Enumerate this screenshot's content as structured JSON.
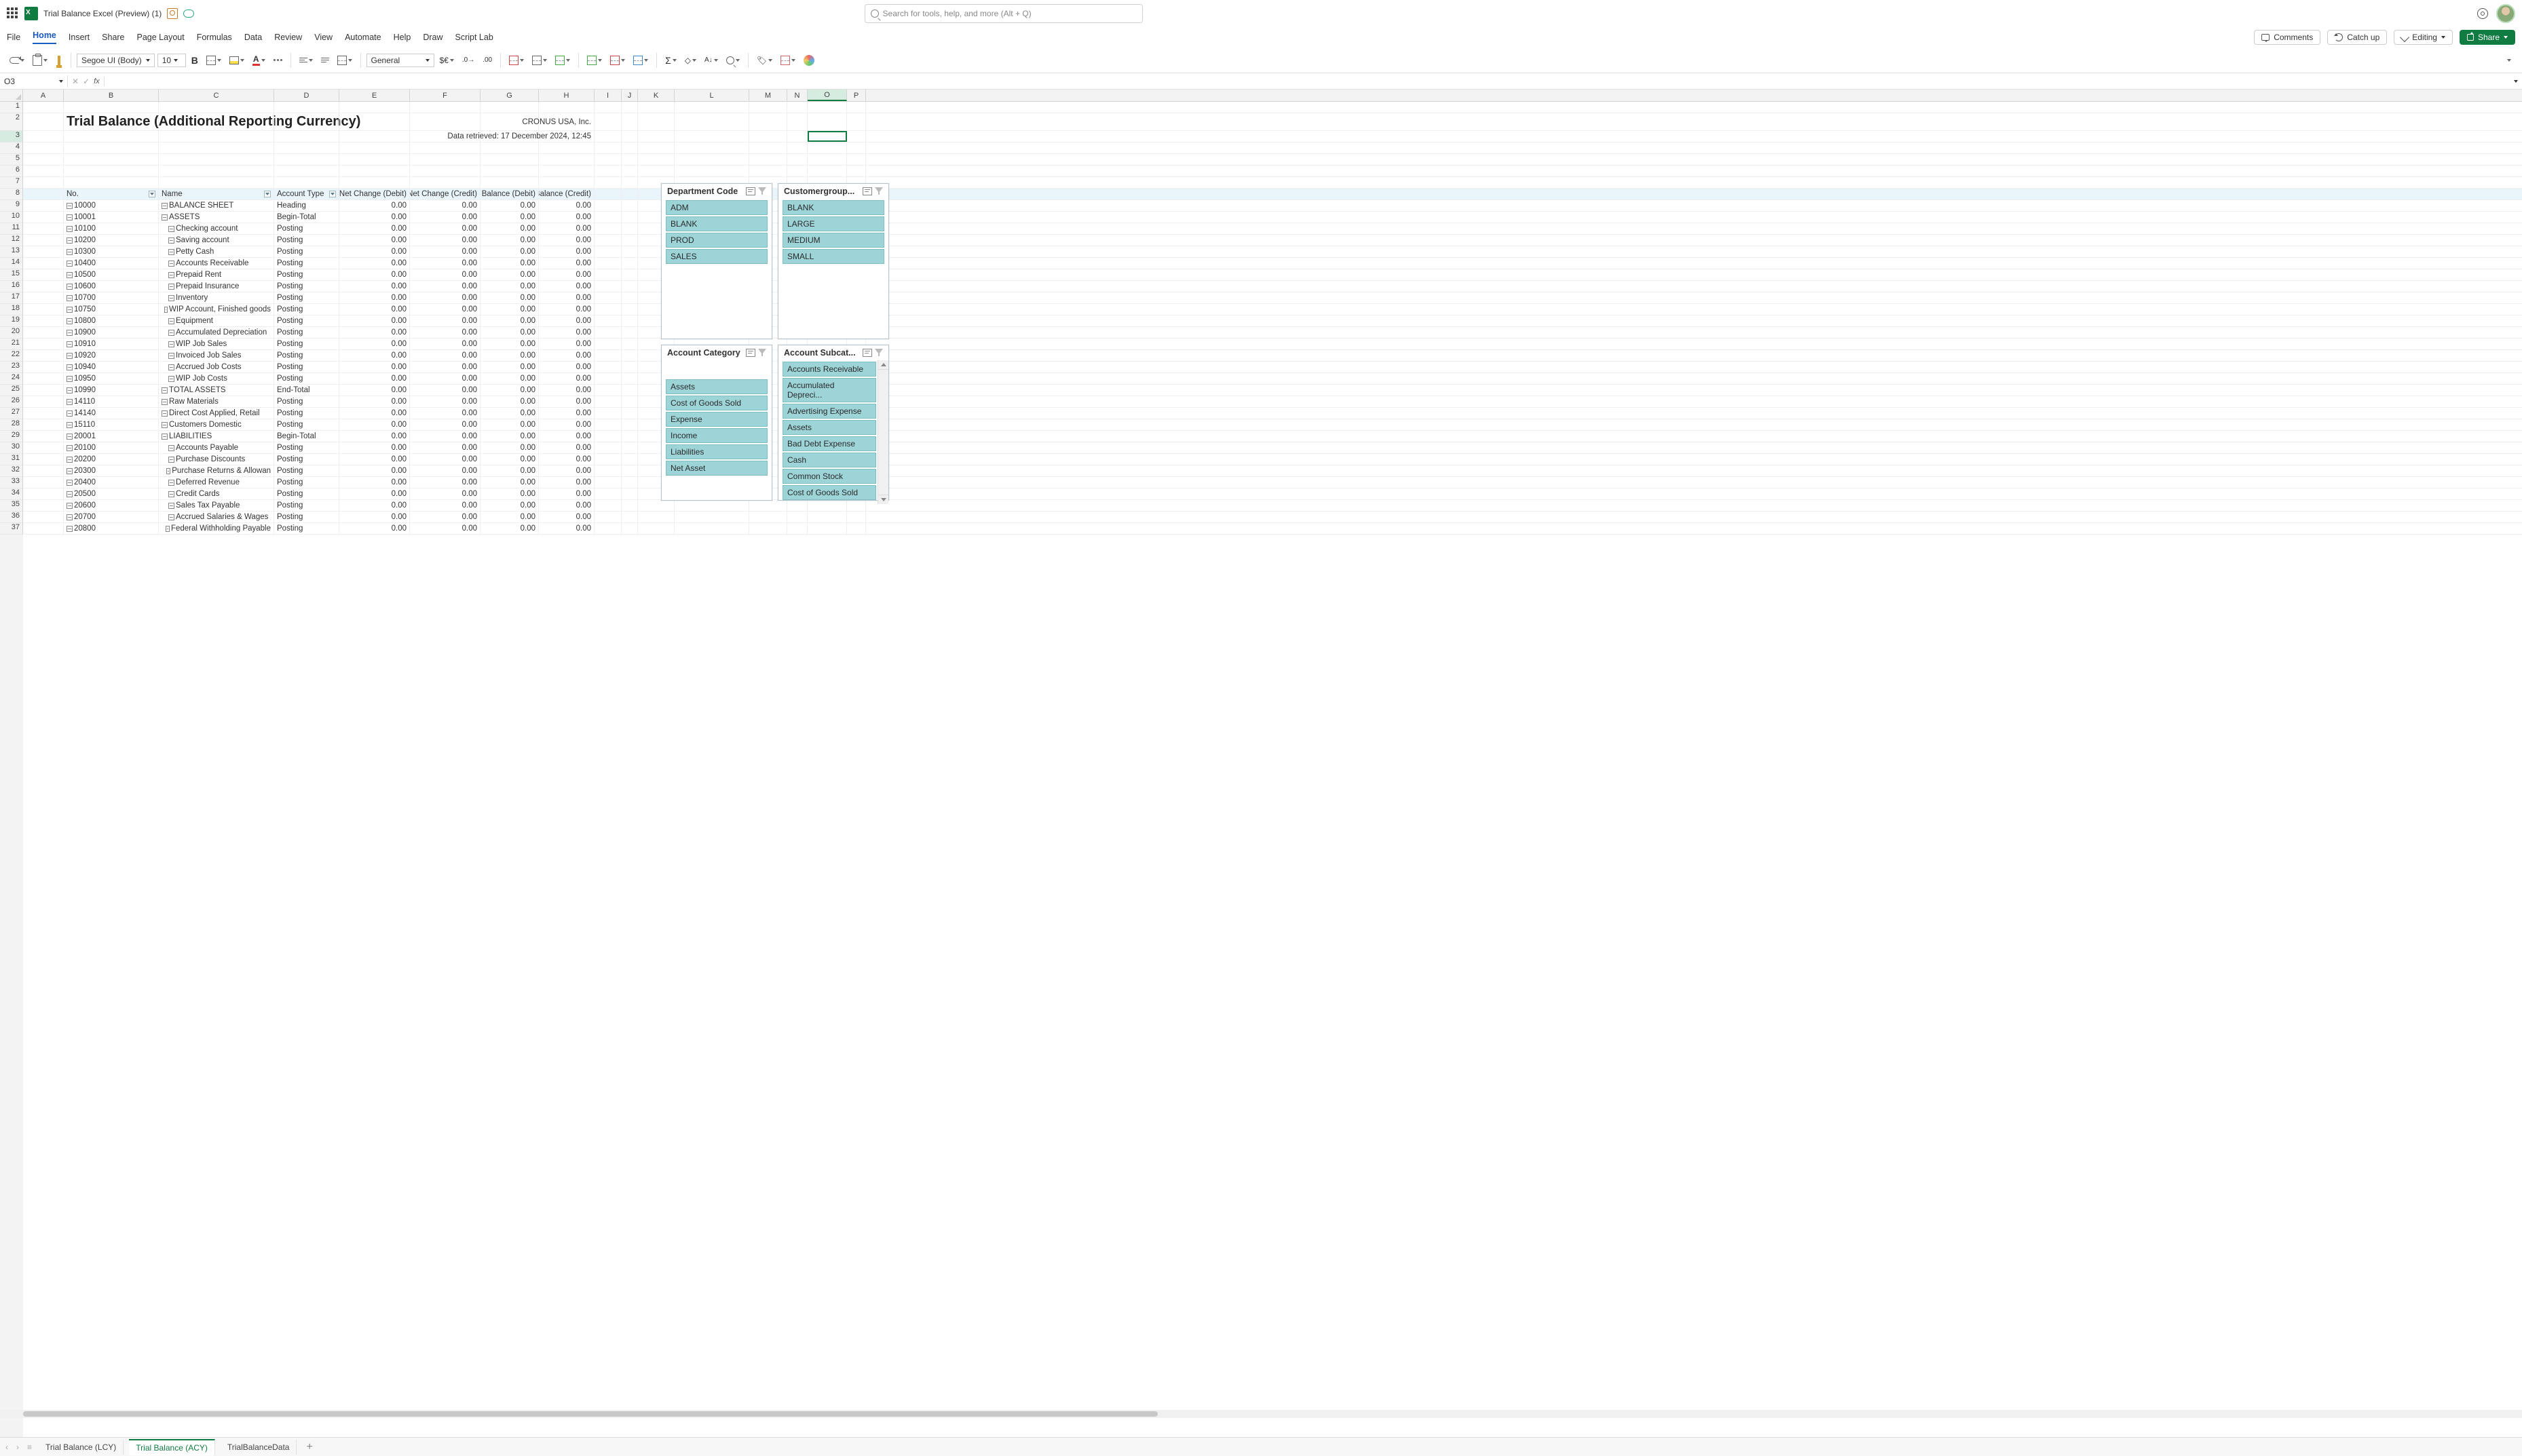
{
  "topbar": {
    "doc_title": "Trial Balance Excel (Preview) (1)",
    "search_placeholder": "Search for tools, help, and more (Alt + Q)"
  },
  "menubar": {
    "items": [
      "File",
      "Home",
      "Insert",
      "Share",
      "Page Layout",
      "Formulas",
      "Data",
      "Review",
      "View",
      "Automate",
      "Help",
      "Draw",
      "Script Lab"
    ],
    "active_index": 1,
    "comments": "Comments",
    "catch_up": "Catch up",
    "editing": "Editing",
    "share": "Share"
  },
  "ribbon": {
    "font_name": "Segoe UI (Body)",
    "font_size": "10",
    "number_format": "General"
  },
  "fxbar": {
    "namebox": "O3",
    "formula": ""
  },
  "columns": [
    "A",
    "B",
    "C",
    "D",
    "E",
    "F",
    "G",
    "H",
    "I",
    "J",
    "K",
    "L",
    "M",
    "N",
    "O",
    "P"
  ],
  "row_count_total": 37,
  "report": {
    "title": "Trial Balance (Additional Reporting Currency)",
    "company": "CRONUS USA, Inc.",
    "retrieved": "Data retrieved: 17 December 2024, 12:45"
  },
  "table": {
    "headers": [
      "No.",
      "Name",
      "Account Type",
      "Net Change (Debit)",
      "Net Change (Credit)",
      "Balance (Debit)",
      "Balance (Credit)"
    ],
    "rows": [
      {
        "no": "10000",
        "name": "BALANCE SHEET",
        "type": "Heading",
        "d": "0.00",
        "e": "0.00",
        "f": "0.00",
        "g": "0.00",
        "oA": true,
        "oB": true
      },
      {
        "no": "10001",
        "name": "ASSETS",
        "type": "Begin-Total",
        "d": "0.00",
        "e": "0.00",
        "f": "0.00",
        "g": "0.00",
        "oA": true,
        "oB": true
      },
      {
        "no": "10100",
        "name": "Checking account",
        "type": "Posting",
        "d": "0.00",
        "e": "0.00",
        "f": "0.00",
        "g": "0.00",
        "oA": true,
        "oB": false,
        "ind": true
      },
      {
        "no": "10200",
        "name": "Saving account",
        "type": "Posting",
        "d": "0.00",
        "e": "0.00",
        "f": "0.00",
        "g": "0.00",
        "oA": true,
        "oB": false,
        "ind": true
      },
      {
        "no": "10300",
        "name": "Petty Cash",
        "type": "Posting",
        "d": "0.00",
        "e": "0.00",
        "f": "0.00",
        "g": "0.00",
        "oA": true,
        "oB": false,
        "ind": true
      },
      {
        "no": "10400",
        "name": "Accounts Receivable",
        "type": "Posting",
        "d": "0.00",
        "e": "0.00",
        "f": "0.00",
        "g": "0.00",
        "oA": true,
        "oB": false,
        "ind": true
      },
      {
        "no": "10500",
        "name": "Prepaid Rent",
        "type": "Posting",
        "d": "0.00",
        "e": "0.00",
        "f": "0.00",
        "g": "0.00",
        "oA": true,
        "oB": false,
        "ind": true
      },
      {
        "no": "10600",
        "name": "Prepaid Insurance",
        "type": "Posting",
        "d": "0.00",
        "e": "0.00",
        "f": "0.00",
        "g": "0.00",
        "oA": true,
        "oB": false,
        "ind": true
      },
      {
        "no": "10700",
        "name": "Inventory",
        "type": "Posting",
        "d": "0.00",
        "e": "0.00",
        "f": "0.00",
        "g": "0.00",
        "oA": true,
        "oB": false,
        "ind": true
      },
      {
        "no": "10750",
        "name": "WIP Account, Finished goods",
        "type": "Posting",
        "d": "0.00",
        "e": "0.00",
        "f": "0.00",
        "g": "0.00",
        "oA": true,
        "oB": false,
        "ind": true
      },
      {
        "no": "10800",
        "name": "Equipment",
        "type": "Posting",
        "d": "0.00",
        "e": "0.00",
        "f": "0.00",
        "g": "0.00",
        "oA": true,
        "oB": false,
        "ind": true
      },
      {
        "no": "10900",
        "name": "Accumulated Depreciation",
        "type": "Posting",
        "d": "0.00",
        "e": "0.00",
        "f": "0.00",
        "g": "0.00",
        "oA": true,
        "oB": false,
        "ind": true
      },
      {
        "no": "10910",
        "name": "WIP Job Sales",
        "type": "Posting",
        "d": "0.00",
        "e": "0.00",
        "f": "0.00",
        "g": "0.00",
        "oA": true,
        "oB": false,
        "ind": true
      },
      {
        "no": "10920",
        "name": "Invoiced Job Sales",
        "type": "Posting",
        "d": "0.00",
        "e": "0.00",
        "f": "0.00",
        "g": "0.00",
        "oA": true,
        "oB": false,
        "ind": true
      },
      {
        "no": "10940",
        "name": "Accrued Job Costs",
        "type": "Posting",
        "d": "0.00",
        "e": "0.00",
        "f": "0.00",
        "g": "0.00",
        "oA": true,
        "oB": false,
        "ind": true
      },
      {
        "no": "10950",
        "name": "WIP Job Costs",
        "type": "Posting",
        "d": "0.00",
        "e": "0.00",
        "f": "0.00",
        "g": "0.00",
        "oA": true,
        "oB": false,
        "ind": true
      },
      {
        "no": "10990",
        "name": "TOTAL ASSETS",
        "type": "End-Total",
        "d": "0.00",
        "e": "0.00",
        "f": "0.00",
        "g": "0.00",
        "oA": true,
        "oB": true
      },
      {
        "no": "14110",
        "name": "Raw Materials",
        "type": "Posting",
        "d": "0.00",
        "e": "0.00",
        "f": "0.00",
        "g": "0.00",
        "oA": true,
        "oB": true
      },
      {
        "no": "14140",
        "name": "Direct Cost Applied, Retail",
        "type": "Posting",
        "d": "0.00",
        "e": "0.00",
        "f": "0.00",
        "g": "0.00",
        "oA": true,
        "oB": true
      },
      {
        "no": "15110",
        "name": "Customers Domestic",
        "type": "Posting",
        "d": "0.00",
        "e": "0.00",
        "f": "0.00",
        "g": "0.00",
        "oA": true,
        "oB": true
      },
      {
        "no": "20001",
        "name": "LIABILITIES",
        "type": "Begin-Total",
        "d": "0.00",
        "e": "0.00",
        "f": "0.00",
        "g": "0.00",
        "oA": true,
        "oB": true
      },
      {
        "no": "20100",
        "name": "Accounts Payable",
        "type": "Posting",
        "d": "0.00",
        "e": "0.00",
        "f": "0.00",
        "g": "0.00",
        "oA": true,
        "oB": false,
        "ind": true
      },
      {
        "no": "20200",
        "name": "Purchase Discounts",
        "type": "Posting",
        "d": "0.00",
        "e": "0.00",
        "f": "0.00",
        "g": "0.00",
        "oA": true,
        "oB": false,
        "ind": true
      },
      {
        "no": "20300",
        "name": "Purchase Returns & Allowan",
        "type": "Posting",
        "d": "0.00",
        "e": "0.00",
        "f": "0.00",
        "g": "0.00",
        "oA": true,
        "oB": false,
        "ind": true
      },
      {
        "no": "20400",
        "name": "Deferred Revenue",
        "type": "Posting",
        "d": "0.00",
        "e": "0.00",
        "f": "0.00",
        "g": "0.00",
        "oA": true,
        "oB": false,
        "ind": true
      },
      {
        "no": "20500",
        "name": "Credit Cards",
        "type": "Posting",
        "d": "0.00",
        "e": "0.00",
        "f": "0.00",
        "g": "0.00",
        "oA": true,
        "oB": false,
        "ind": true
      },
      {
        "no": "20600",
        "name": "Sales Tax Payable",
        "type": "Posting",
        "d": "0.00",
        "e": "0.00",
        "f": "0.00",
        "g": "0.00",
        "oA": true,
        "oB": false,
        "ind": true
      },
      {
        "no": "20700",
        "name": "Accrued Salaries & Wages",
        "type": "Posting",
        "d": "0.00",
        "e": "0.00",
        "f": "0.00",
        "g": "0.00",
        "oA": true,
        "oB": false,
        "ind": true
      },
      {
        "no": "20800",
        "name": "Federal Withholding Payable",
        "type": "Posting",
        "d": "0.00",
        "e": "0.00",
        "f": "0.00",
        "g": "0.00",
        "oA": true,
        "oB": false,
        "ind": true
      }
    ]
  },
  "slicers": {
    "department": {
      "title": "Department Code",
      "items": [
        "ADM",
        "BLANK",
        "PROD",
        "SALES"
      ]
    },
    "customergroup": {
      "title": "Customergroup...",
      "items": [
        "BLANK",
        "LARGE",
        "MEDIUM",
        "SMALL"
      ]
    },
    "account_category": {
      "title": "Account Category",
      "items": [
        "Assets",
        "Cost of Goods Sold",
        "Expense",
        "Income",
        "Liabilities",
        "Net Asset"
      ]
    },
    "account_subcat": {
      "title": "Account Subcat...",
      "items": [
        "Accounts Receivable",
        "Accumulated Depreci...",
        "Advertising Expense",
        "Assets",
        "Bad Debt Expense",
        "Cash",
        "Common Stock",
        "Cost of Goods Sold"
      ]
    }
  },
  "tabs": {
    "sheets": [
      "Trial Balance (LCY)",
      "Trial Balance (ACY)",
      "TrialBalanceData"
    ],
    "active_index": 1
  },
  "colors": {
    "accent": "#107c41",
    "slicer_item": "#9dd4d8"
  }
}
